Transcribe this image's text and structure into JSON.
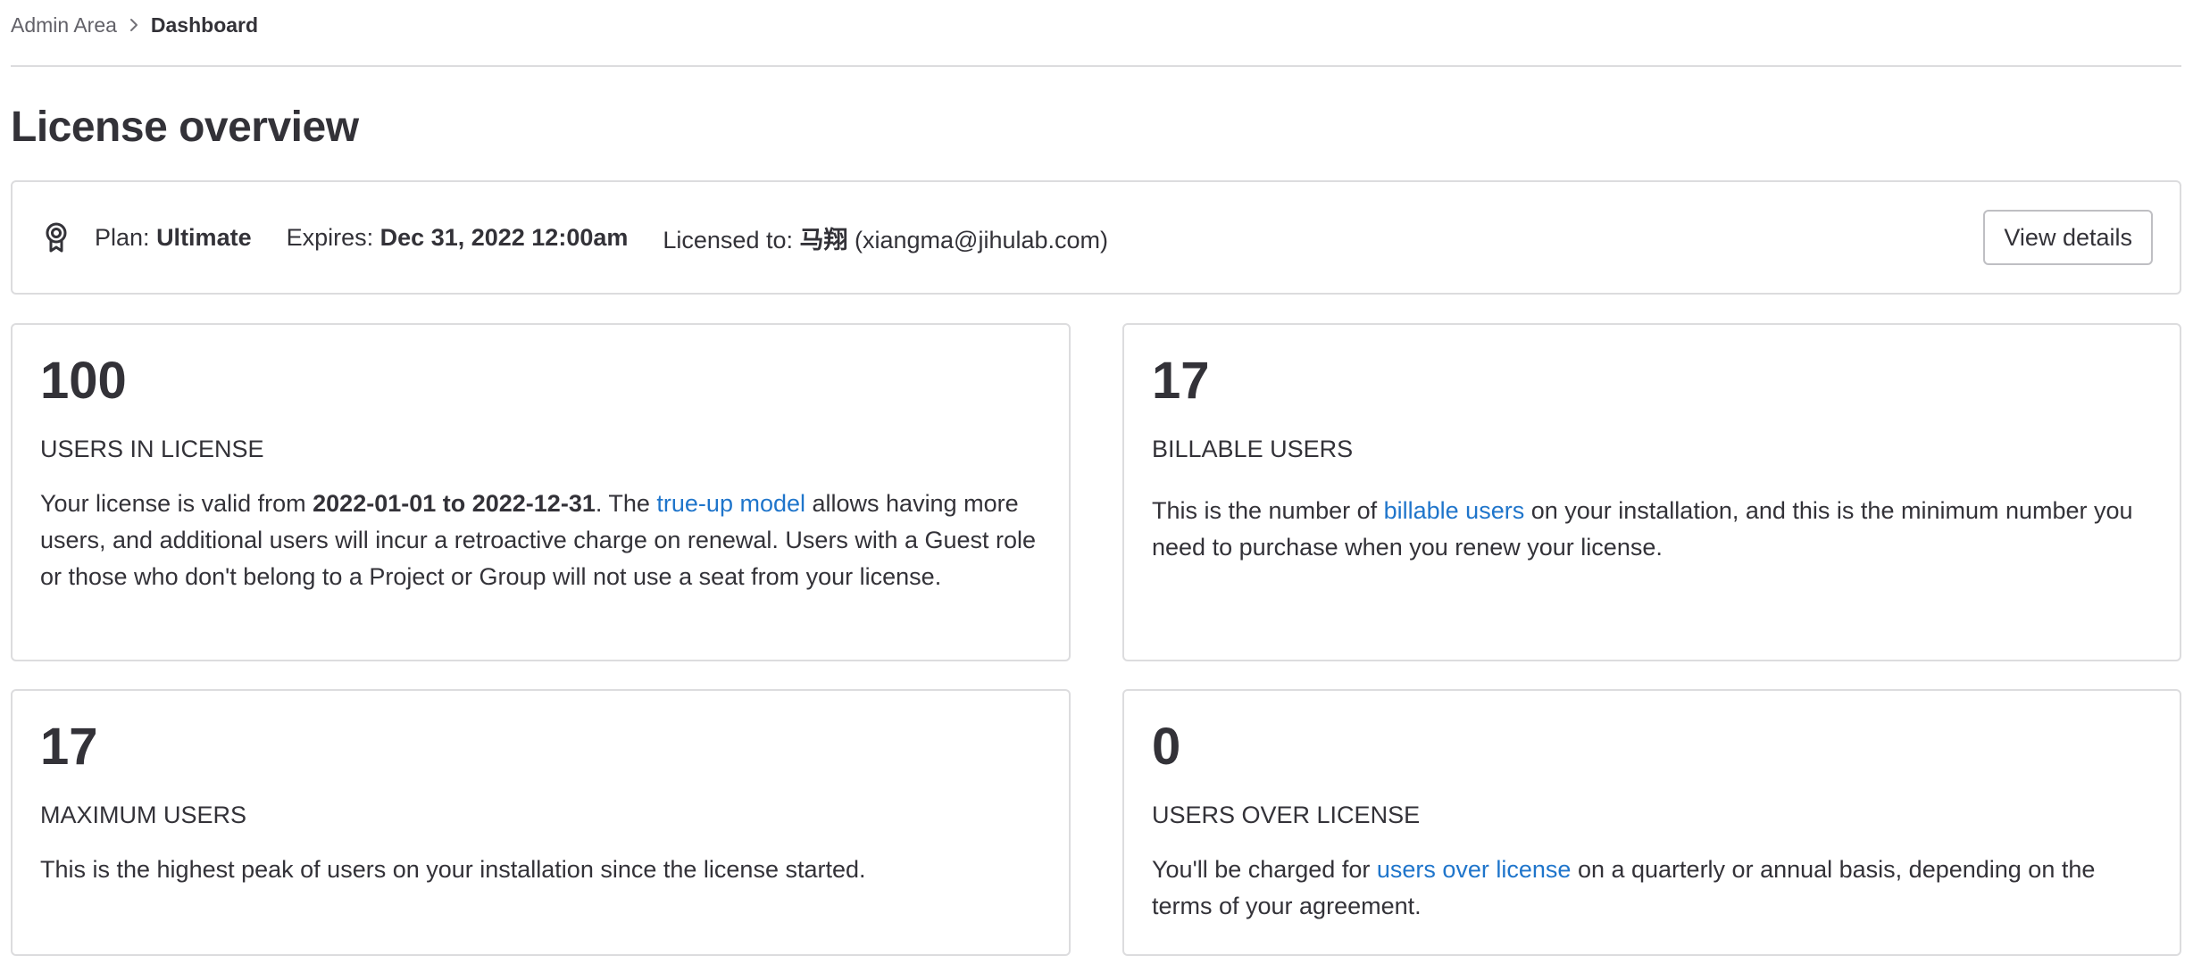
{
  "breadcrumb": {
    "parent": "Admin Area",
    "current": "Dashboard"
  },
  "page_title": "License overview",
  "license": {
    "icon": "license-badge-icon",
    "plan_label": "Plan:",
    "plan_value": "Ultimate",
    "expires_label": "Expires:",
    "expires_value": "Dec 31, 2022 12:00am",
    "licensed_to_label": "Licensed to:",
    "licensee_name": "马翔",
    "licensee_email": "(xiangma@jihulab.com)",
    "view_details_label": "View details"
  },
  "stats": {
    "users_in_license": {
      "value": "100",
      "label": "USERS IN LICENSE",
      "desc_1": "Your license is valid from ",
      "desc_bold": "2022-01-01 to 2022-12-31",
      "desc_2": ". The ",
      "link": "true-up model",
      "desc_3": " allows having more users, and additional users will incur a retroactive charge on renewal. Users with a Guest role or those who don't belong to a Project or Group will not use a seat from your license."
    },
    "billable_users": {
      "value": "17",
      "label": "BILLABLE USERS",
      "desc_1": "This is the number of ",
      "link": "billable users",
      "desc_2": " on your installation, and this is the minimum number you need to purchase when you renew your license."
    },
    "maximum_users": {
      "value": "17",
      "label": "MAXIMUM USERS",
      "desc": "This is the highest peak of users on your installation since the license started."
    },
    "users_over_license": {
      "value": "0",
      "label": "USERS OVER LICENSE",
      "desc_1": "You'll be charged for ",
      "link": "users over license",
      "desc_2": " on a quarterly or annual basis, depending on the terms of your agreement."
    }
  },
  "colors": {
    "link": "#1f75cb",
    "text": "#333238",
    "border": "#dcdcde"
  }
}
